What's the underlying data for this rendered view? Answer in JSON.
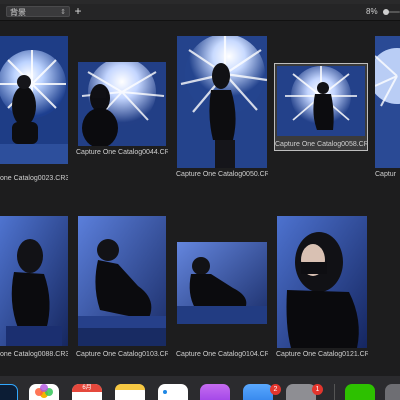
{
  "toolbar": {
    "background_select_value": "背景",
    "add_label": "+",
    "zoom_level": "8%"
  },
  "thumbnails": [
    {
      "caption": "one Catalog0023.CR3",
      "selected": false
    },
    {
      "caption": "Capture One Catalog0044.CR3",
      "selected": false
    },
    {
      "caption": "Capture One Catalog0050.CR3",
      "selected": false
    },
    {
      "caption": "Capture One Catalog0058.CR3",
      "selected": true
    },
    {
      "caption": "Captur",
      "selected": false
    },
    {
      "caption": "one Catalog0088.CR3",
      "selected": false
    },
    {
      "caption": "Capture One Catalog0103.CR3",
      "selected": false
    },
    {
      "caption": "Capture One Catalog0104.CR3",
      "selected": false
    },
    {
      "caption": "Capture One Catalog0121.CR3",
      "selected": false
    }
  ],
  "dock": {
    "calendar_month": "6月",
    "badge_1": "2",
    "badge_2": "1"
  },
  "colors": {
    "grid_background": "#1d1d1e",
    "selection_outline": "#bdbdbd",
    "photo_blue": "#3b5fb0"
  }
}
